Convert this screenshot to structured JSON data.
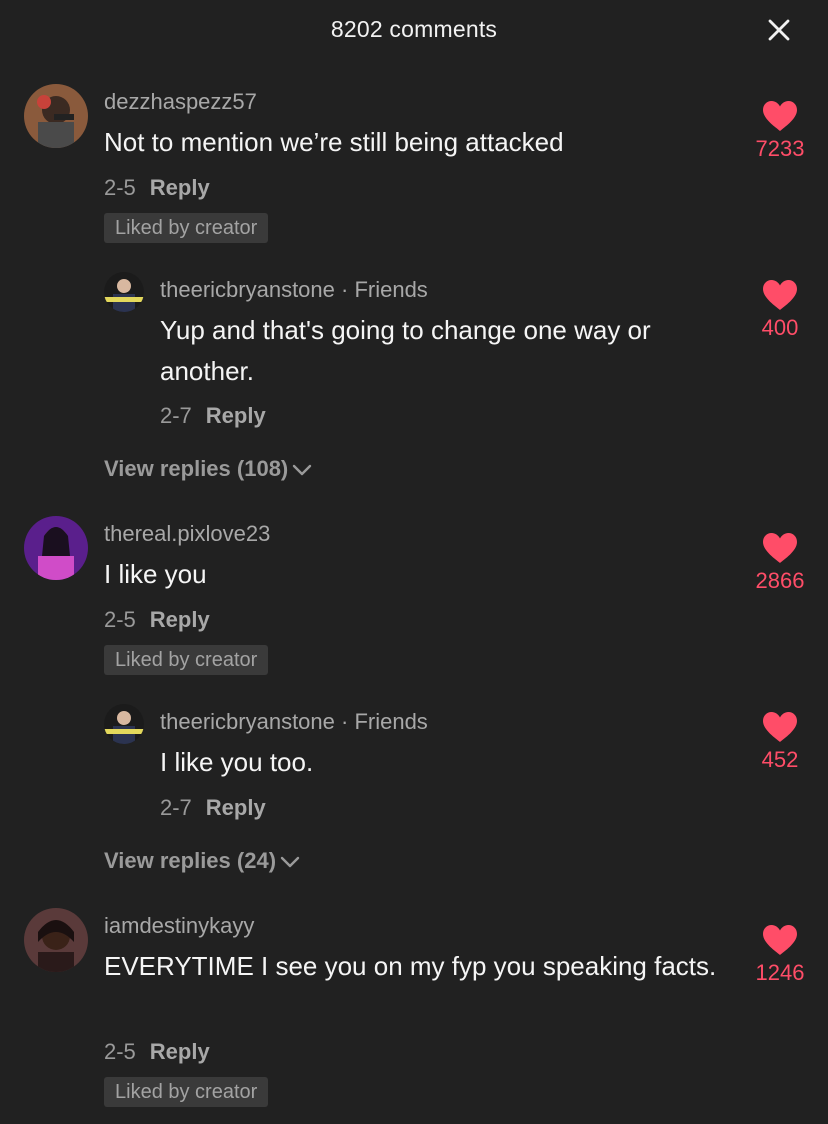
{
  "header": {
    "title": "8202 comments",
    "close_icon": "close-icon"
  },
  "colors": {
    "background": "#212121",
    "like_accent": "#ff4d68",
    "muted_text": "#a8a8a8",
    "badge_bg": "#3a3a3a"
  },
  "comments": [
    {
      "username": "dezzhaspezz57",
      "text": "Not to mention we’re still being attacked",
      "date": "2-5",
      "reply_label": "Reply",
      "badge": "Liked by creator",
      "likes": "7233",
      "reply": {
        "username": "theericbryanstone",
        "tag": " · Friends",
        "text": "Yup and that's going to change one way or another.",
        "date": "2-7",
        "reply_label": "Reply",
        "likes": "400"
      },
      "view_replies": "View replies (108)"
    },
    {
      "username": "thereal.pixlove23",
      "text": "I like you",
      "date": "2-5",
      "reply_label": "Reply",
      "badge": "Liked by creator",
      "likes": "2866",
      "reply": {
        "username": "theericbryanstone",
        "tag": " · Friends",
        "text": "I like you too.",
        "date": "2-7",
        "reply_label": "Reply",
        "likes": "452"
      },
      "view_replies": "View replies (24)"
    },
    {
      "username": "iamdestinykayy",
      "text": "EVERYTIME I see you on my fyp you speaking facts.",
      "date": "2-5",
      "reply_label": "Reply",
      "badge": "Liked by creator",
      "likes": "1246"
    }
  ]
}
